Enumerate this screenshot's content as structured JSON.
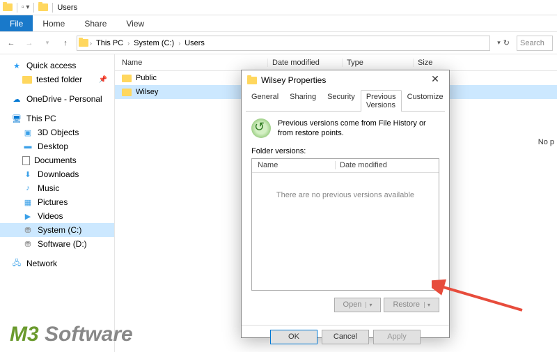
{
  "window": {
    "title": "Users"
  },
  "menu": {
    "file": "File",
    "home": "Home",
    "share": "Share",
    "view": "View"
  },
  "nav": {
    "crumbs": [
      "This PC",
      "System (C:)",
      "Users"
    ],
    "search_placeholder": "Search"
  },
  "sidebar": {
    "quick_access": "Quick access",
    "tested_folder": "tested folder",
    "onedrive": "OneDrive - Personal",
    "this_pc": "This PC",
    "objects3d": "3D Objects",
    "desktop": "Desktop",
    "documents": "Documents",
    "downloads": "Downloads",
    "music": "Music",
    "pictures": "Pictures",
    "videos": "Videos",
    "system_c": "System (C:)",
    "software_d": "Software (D:)",
    "network": "Network"
  },
  "columns": {
    "name": "Name",
    "date": "Date modified",
    "type": "Type",
    "size": "Size"
  },
  "files": {
    "row0": "Public",
    "row1": "Wilsey"
  },
  "right_msg": "No p",
  "dialog": {
    "title": "Wilsey Properties",
    "tabs": {
      "general": "General",
      "sharing": "Sharing",
      "security": "Security",
      "prev": "Previous Versions",
      "customize": "Customize"
    },
    "info": "Previous versions come from File History or from restore points.",
    "folder_versions": "Folder versions:",
    "col_name": "Name",
    "col_date": "Date modified",
    "empty": "There are no previous versions available",
    "open": "Open",
    "restore": "Restore",
    "ok": "OK",
    "cancel": "Cancel",
    "apply": "Apply"
  },
  "logo": {
    "m3": "M3",
    "soft": " Software"
  }
}
